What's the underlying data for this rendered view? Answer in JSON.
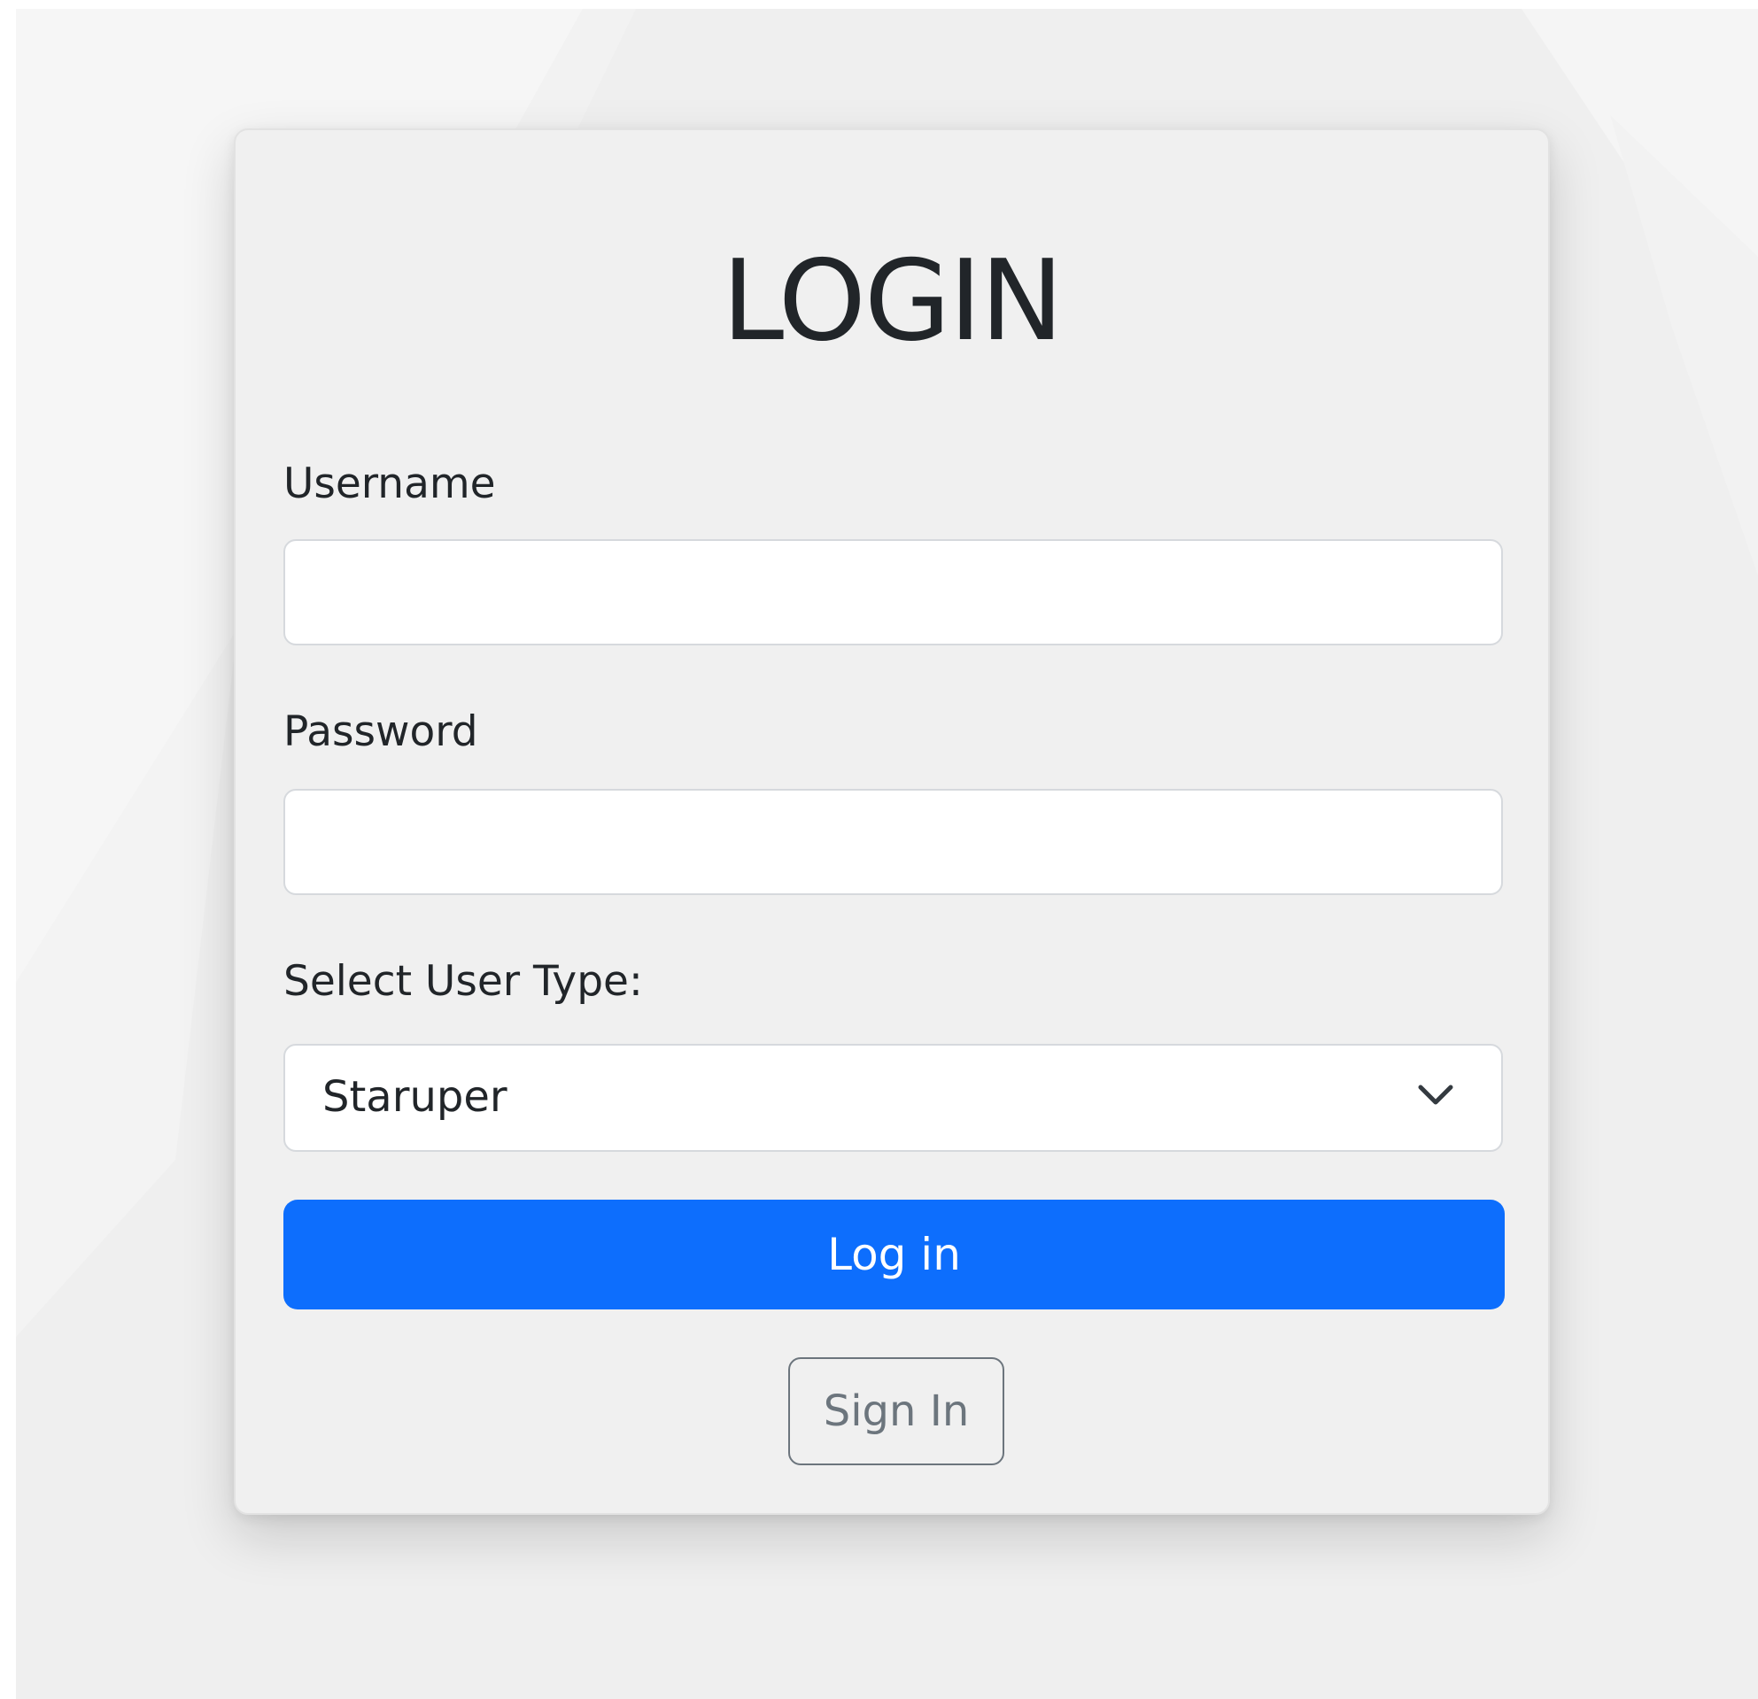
{
  "login_form": {
    "title": "LOGIN",
    "username": {
      "label": "Username",
      "value": "",
      "placeholder": ""
    },
    "password": {
      "label": "Password",
      "value": "",
      "placeholder": ""
    },
    "user_type": {
      "label": "Select User Type:",
      "selected": "Staruper"
    },
    "primary_button": "Log in",
    "secondary_button": "Sign In"
  },
  "colors": {
    "primary": "#0d6efd",
    "secondary": "#6c757d",
    "text": "#212529",
    "card_background": "#f0f0f0",
    "page_background": "#efefef"
  },
  "icons": {
    "select_indicator": "chevron-down-icon"
  }
}
